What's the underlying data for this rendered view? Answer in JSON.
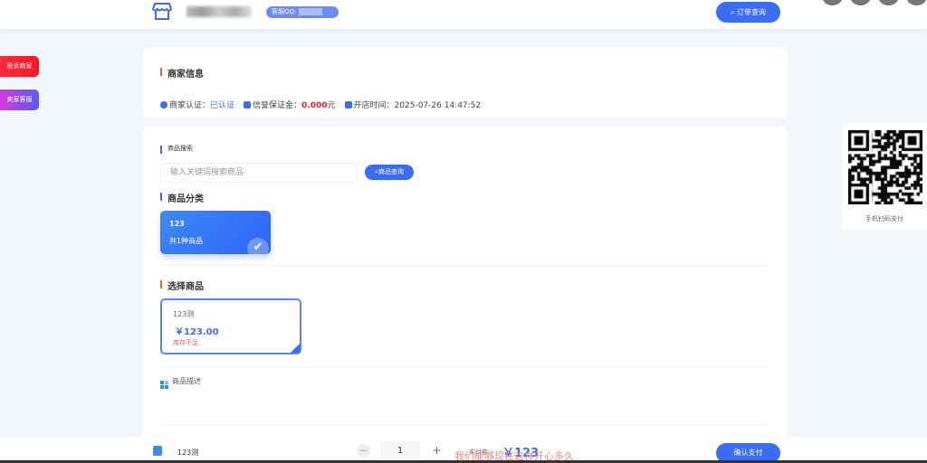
{
  "header": {
    "qq_label": "客服QQ:",
    "order_button": "订单查询"
  },
  "side": {
    "complain": "投诉商家",
    "service": "卖家客服"
  },
  "merchant": {
    "title": "商家信息",
    "cert_label": "商家认证：",
    "cert_value": "已认证",
    "deposit_label": "信誉保证金：",
    "deposit_value": "0.000",
    "deposit_unit": "元",
    "open_label": "开店时间：",
    "open_value": "2025-07-26 14:47:52"
  },
  "search": {
    "title": "商品搜索",
    "placeholder": "输入关键词搜索商品",
    "button": "商品查询"
  },
  "category": {
    "title": "商品分类",
    "items": [
      {
        "name": "123",
        "count": "共1种商品",
        "selected": true
      }
    ]
  },
  "products": {
    "title": "选择商品",
    "items": [
      {
        "name": "123测",
        "price": "￥123.00",
        "stock": "库存不足"
      }
    ]
  },
  "description": {
    "title": "商品描述"
  },
  "qr": {
    "caption": "手机扫码支付"
  },
  "bottom": {
    "product": "123测",
    "minus": "−",
    "quantity": "1",
    "plus": "+",
    "pay_label": "实付款:",
    "total": "￥123",
    "marquee": "我们能够现在这样开心多久",
    "confirm": "确认支付"
  },
  "colors": {
    "accent": "#3a6cf6",
    "danger": "#f0222b"
  }
}
